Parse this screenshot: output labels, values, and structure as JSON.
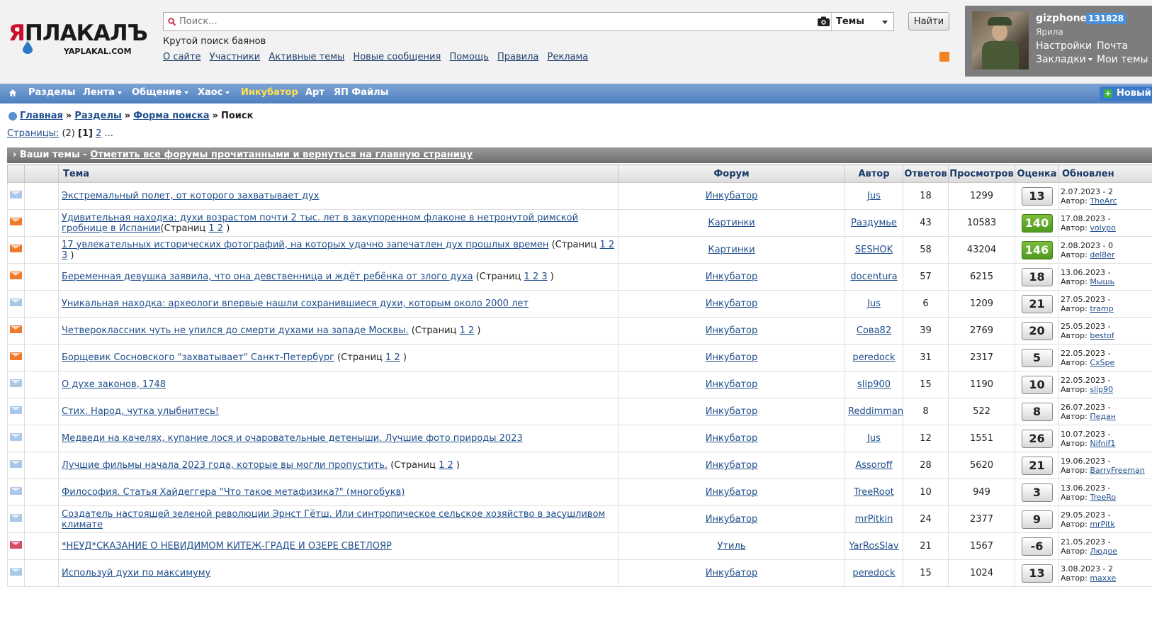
{
  "logo": {
    "word_red": "Я",
    "word_rest": "ПЛАКАЛЪ",
    "domain": "YAPLAKAL.COM"
  },
  "search": {
    "placeholder": "Поиск...",
    "scope": "Темы",
    "button": "Найти"
  },
  "tagline": "Крутой поиск баянов",
  "top_links": [
    "О сайте",
    "Участники",
    "Активные темы",
    "Новые сообщения",
    "Помощь",
    "Правила",
    "Реклама"
  ],
  "user": {
    "name": "gizphone",
    "karma": "131828",
    "rank": "Ярила",
    "settings": "Настройки",
    "mail": "Почта",
    "bookmarks": "Закладки",
    "my_topics": "Мои темы"
  },
  "nav": {
    "items": [
      "Разделы",
      "Лента",
      "Общение",
      "Хаос",
      "Инкубатор",
      "Арт",
      "ЯП Файлы"
    ],
    "new_button": "Новый"
  },
  "breadcrumb": {
    "home": "Главная",
    "sections": "Разделы",
    "search_form": "Форма поиска",
    "current": "Поиск",
    "sep": "»"
  },
  "pages": {
    "label": "Страницы:",
    "count": "(2)",
    "current": "[1]",
    "next": "2",
    "more": "..."
  },
  "topics_bar": {
    "prefix": "› Ваши темы - ",
    "link": "Отметить все форумы прочитанными и вернуться на главную страницу"
  },
  "columns": {
    "topic": "Тема",
    "forum": "Форум",
    "author": "Автор",
    "replies": "Ответов",
    "views": "Просмотров",
    "rating": "Оценка",
    "updated": "Обновлен"
  },
  "colors": {
    "nav_top": "#7da3d4",
    "nav_bottom": "#4e7fc0",
    "highlight_nav": "#ffe24a",
    "rating_green": "#5aa526",
    "envelope_blue": "#a9c7e6",
    "envelope_orange": "#f07a2c"
  },
  "rows": [
    {
      "icon": "blue",
      "title": "Экстремальный полет, от которого захватывает дух",
      "pages_label": "",
      "pages": "",
      "forum": "Инкубатор",
      "author": "Jus",
      "replies": "18",
      "views": "1299",
      "rating": "13",
      "rating_style": "",
      "upd_date": "2.07.2023 - 2",
      "upd_author": "TheArc"
    },
    {
      "icon": "orange",
      "title": "Удивительная находка: духи возрастом почти 2 тыс. лет в закупоренном флаконе в нетронутой римской гробнице в Испании",
      "pages_label": "(Страниц ",
      "pages": "1 2",
      "forum": "Картинки",
      "author": "Раздумье",
      "replies": "43",
      "views": "10583",
      "rating": "140",
      "rating_style": "green",
      "upd_date": "17.08.2023 -",
      "upd_author": "volypo"
    },
    {
      "icon": "orange",
      "title": "17 увлекательных исторических фотографий, на которых удачно запечатлен дух прошлых времен",
      "pages_label": " (Страниц ",
      "pages": "1 2 3",
      "forum": "Картинки",
      "author": "SESHOK",
      "replies": "58",
      "views": "43204",
      "rating": "146",
      "rating_style": "green",
      "upd_date": "2.08.2023 - 0",
      "upd_author": "del8er"
    },
    {
      "icon": "orange",
      "title": "Беременная девушка заявила, что она девственница и ждёт ребёнка от злого духа",
      "pages_label": " (Страниц ",
      "pages": "1 2 3",
      "forum": "Инкубатор",
      "author": "docentura",
      "replies": "57",
      "views": "6215",
      "rating": "18",
      "rating_style": "",
      "upd_date": "13.06.2023 -",
      "upd_author": "Мышь"
    },
    {
      "icon": "blue",
      "title": "Уникальная находка: археологи впервые нашли сохранившиеся духи, которым около 2000 лет",
      "pages_label": "",
      "pages": "",
      "forum": "Инкубатор",
      "author": "Jus",
      "replies": "6",
      "views": "1209",
      "rating": "21",
      "rating_style": "",
      "upd_date": "27.05.2023 -",
      "upd_author": "tramp"
    },
    {
      "icon": "orange",
      "title": "Четвероклассник чуть не упился до смерти духами на западе Москвы.",
      "pages_label": " (Страниц ",
      "pages": "1 2",
      "forum": "Инкубатор",
      "author": "Сова82",
      "replies": "39",
      "views": "2769",
      "rating": "20",
      "rating_style": "",
      "upd_date": "25.05.2023 -",
      "upd_author": "bestof"
    },
    {
      "icon": "orange",
      "title": "Борщевик Сосновского \"захватывает\" Санкт-Петербург",
      "pages_label": " (Страниц ",
      "pages": "1 2",
      "forum": "Инкубатор",
      "author": "peredock",
      "replies": "31",
      "views": "2317",
      "rating": "5",
      "rating_style": "",
      "upd_date": "22.05.2023 -",
      "upd_author": "CxSpe"
    },
    {
      "icon": "blue",
      "title": "О духе законов, 1748",
      "pages_label": "",
      "pages": "",
      "forum": "Инкубатор",
      "author": "slip900",
      "replies": "15",
      "views": "1190",
      "rating": "10",
      "rating_style": "",
      "upd_date": "22.05.2023 -",
      "upd_author": "slip90"
    },
    {
      "icon": "blue",
      "title": "Стих. Народ, чутка улыбнитесь!",
      "pages_label": "",
      "pages": "",
      "forum": "Инкубатор",
      "author": "Reddimman",
      "replies": "8",
      "views": "522",
      "rating": "8",
      "rating_style": "",
      "upd_date": "26.07.2023 -",
      "upd_author": "Педан"
    },
    {
      "icon": "blue",
      "title": "Медведи на качелях, купание лося и очаровательные детеныши. Лучшие фото природы 2023",
      "pages_label": "",
      "pages": "",
      "forum": "Инкубатор",
      "author": "Jus",
      "replies": "12",
      "views": "1551",
      "rating": "26",
      "rating_style": "",
      "upd_date": "10.07.2023 -",
      "upd_author": "Nifnif1"
    },
    {
      "icon": "blue",
      "title": "Лучшие фильмы начала 2023 года, которые вы могли пропустить.",
      "pages_label": " (Страниц ",
      "pages": "1 2",
      "forum": "Инкубатор",
      "author": "Assoroff",
      "replies": "28",
      "views": "5620",
      "rating": "21",
      "rating_style": "",
      "upd_date": "19.06.2023 -",
      "upd_author": "BarryFreeman",
      "upd_wrap": true
    },
    {
      "icon": "blue",
      "title": "Философия. Статья Хайдеггера \"Что такое метафизика?\" (многобукв)",
      "pages_label": "",
      "pages": "",
      "forum": "Инкубатор",
      "author": "TreeRoot",
      "replies": "10",
      "views": "949",
      "rating": "3",
      "rating_style": "",
      "upd_date": "13.06.2023 -",
      "upd_author": "TreeRo"
    },
    {
      "icon": "blue",
      "title": "Создатель настоящей зеленой революции Эрнст Гётш. Или синтропическое сельское хозяйство в засушливом климате",
      "pages_label": "",
      "pages": "",
      "forum": "Инкубатор",
      "author": "mrPitkin",
      "replies": "24",
      "views": "2377",
      "rating": "9",
      "rating_style": "",
      "upd_date": "29.05.2023 -",
      "upd_author": "mrPitk"
    },
    {
      "icon": "pin",
      "title": "*НЕУД*СКАЗАНИЕ О НЕВИДИМОМ КИТЕЖ-ГРАДЕ И ОЗЕРЕ СВЕТЛОЯР",
      "pages_label": "",
      "pages": "",
      "forum": "Утиль",
      "author": "YarRosSlav",
      "replies": "21",
      "views": "1567",
      "rating": "-6",
      "rating_style": "",
      "upd_date": "21.05.2023 -",
      "upd_author": "Людое"
    },
    {
      "icon": "blue",
      "title": "Используй духи по максимуму",
      "pages_label": "",
      "pages": "",
      "forum": "Инкубатор",
      "author": "peredock",
      "replies": "15",
      "views": "1024",
      "rating": "13",
      "rating_style": "",
      "upd_date": "3.08.2023 - 2",
      "upd_author": "maxxe"
    }
  ],
  "row_author_prefix": "Автор:"
}
